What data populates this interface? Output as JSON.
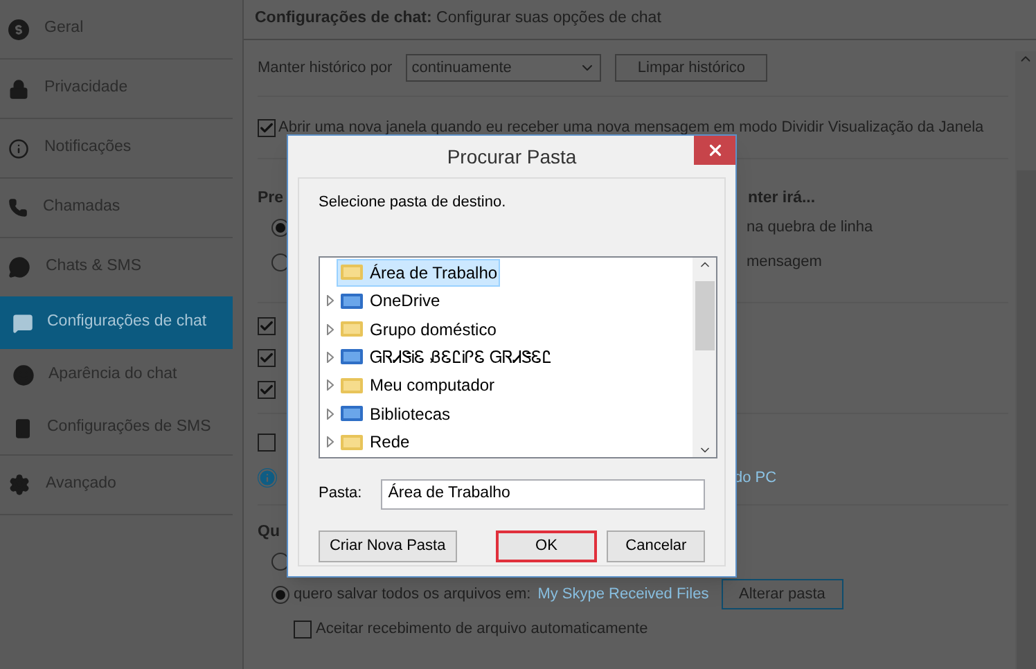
{
  "sidebar": {
    "items": [
      {
        "label": "Geral",
        "selected": false
      },
      {
        "label": "Privacidade",
        "selected": false
      },
      {
        "label": "Notificações",
        "selected": false
      },
      {
        "label": "Chamadas",
        "selected": false
      },
      {
        "label": "Chats & SMS",
        "selected": false,
        "children": [
          {
            "label": "Configurações de chat",
            "selected": true
          },
          {
            "label": "Aparência do chat",
            "selected": false
          },
          {
            "label": "Configurações de SMS",
            "selected": false
          }
        ]
      },
      {
        "label": "Avançado",
        "selected": false
      }
    ]
  },
  "header": {
    "title": "**Configurações de chat:** Configurar suas opções de chat"
  },
  "history": {
    "label": "Manter histórico por",
    "value": "continuamente",
    "button": "Limpar histórico"
  },
  "split_window": {
    "label": "Abrir uma nova janela quando eu receber uma nova mensagem em modo Dividir Visualização da Janela",
    "checked": true
  },
  "section_1": {
    "heading": "Pre",
    "heading_right": "nter irá...",
    "radios": [
      {
        "text": "na quebra de linha",
        "selected": true
      },
      {
        "text": "mensagem",
        "selected": false
      }
    ]
  },
  "checkboxes": [
    {
      "checked": true
    },
    {
      "checked": true
    },
    {
      "checked": true
    },
    {
      "checked": false
    }
  ],
  "info_link": "do PC",
  "section_2": {
    "heading": "Qu",
    "radios": [
      {
        "selected": false
      },
      {
        "text": "quero salvar todos os arquivos em:",
        "link": "My Skype Received Files",
        "selected": true
      }
    ],
    "button": "Alterar pasta",
    "auto_accept": {
      "label": "Aceitar recebimento de arquivo automaticamente",
      "checked": false
    }
  },
  "dialog": {
    "title": "Procurar Pasta",
    "prompt": "Selecione pasta de destino.",
    "tree": [
      {
        "label": "Área de Trabalho",
        "expandable": false,
        "selected": true
      },
      {
        "label": "OneDrive",
        "expandable": true,
        "selected": false
      },
      {
        "label": "Grupo doméstico",
        "expandable": true,
        "selected": false
      },
      {
        "label": "ᏀᏒᏗᏕᎥᏋ ᏰᏋᏝᎥᎵᏋ ᏀᏒᏗᏕᏋᏝ",
        "expandable": true,
        "selected": false
      },
      {
        "label": "Meu computador",
        "expandable": true,
        "selected": false
      },
      {
        "label": "Bibliotecas",
        "expandable": true,
        "selected": false
      },
      {
        "label": "Rede",
        "expandable": true,
        "selected": false
      }
    ],
    "folder_label": "Pasta:",
    "folder_value": "Área de Trabalho",
    "buttons": [
      {
        "label": "Criar Nova Pasta",
        "focused": false
      },
      {
        "label": "OK",
        "focused": true
      },
      {
        "label": "Cancelar",
        "focused": false
      }
    ]
  }
}
